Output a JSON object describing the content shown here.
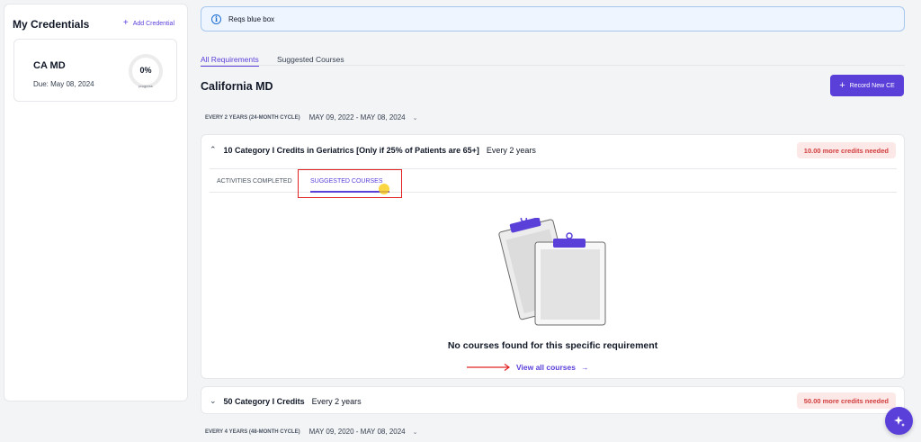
{
  "sidebar": {
    "title": "My Credentials",
    "add_label": "Add Credential",
    "credential": {
      "name": "CA MD",
      "due": "Due: May 08, 2024",
      "progress_pct": "0%",
      "progress_label": "progress",
      "progress_value": 0
    }
  },
  "info": {
    "text": "Reqs blue box"
  },
  "tabs": [
    {
      "label": "All Requirements",
      "active": true
    },
    {
      "label": "Suggested Courses",
      "active": false
    }
  ],
  "page": {
    "title": "California MD",
    "record_label": "Record New CE"
  },
  "cycles": [
    {
      "label": "EVERY 2 YEARS (24-MONTH CYCLE)",
      "dates": "MAY 09, 2022 - MAY 08, 2024"
    },
    {
      "label": "EVERY 4 YEARS (48-MONTH CYCLE)",
      "dates": "MAY 09, 2020 - MAY 08, 2024"
    }
  ],
  "requirements": [
    {
      "title": "10 Category I Credits in Geriatrics [Only if 25% of Patients are 65+]",
      "frequency": "Every 2 years",
      "needed": "10.00 more credits needed",
      "tabs": [
        "ACTIVITIES COMPLETED",
        "SUGGESTED COURSES"
      ],
      "empty_message": "No courses found for this specific requirement",
      "view_all": "View all courses"
    },
    {
      "title": "50 Category I Credits",
      "frequency": "Every 2 years",
      "needed": "50.00 more credits needed"
    }
  ],
  "colors": {
    "accent": "#5b3fd9",
    "alert_bg": "#fde8e8",
    "alert_text": "#d13c3c",
    "info_bg": "#eef5ff"
  },
  "icons": {
    "info": "info-icon",
    "plus": "plus-icon",
    "chevron": "chevron-icon",
    "arrow": "arrow-right-icon",
    "fab": "sparkle-icon"
  }
}
